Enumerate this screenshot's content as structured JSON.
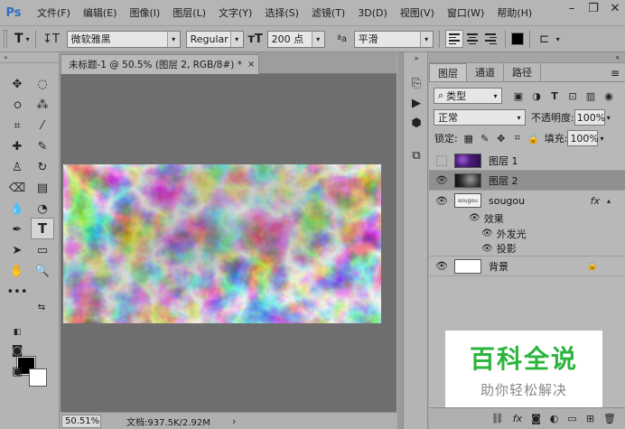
{
  "menubar": {
    "logo": "Ps",
    "items": [
      "文件(F)",
      "编辑(E)",
      "图像(I)",
      "图层(L)",
      "文字(Y)",
      "选择(S)",
      "滤镜(T)",
      "3D(D)",
      "视图(V)",
      "窗口(W)",
      "帮助(H)"
    ],
    "controls": [
      "minimize-icon",
      "restore-icon",
      "close-icon"
    ]
  },
  "options": {
    "font_family": "微软雅黑",
    "font_style": "Regular",
    "font_size": "200 点",
    "aa_label": "ªa",
    "antialias": "平滑"
  },
  "document": {
    "tab_title": "未标题-1 @ 50.5% (图层 2, RGB/8#) *",
    "close": "×"
  },
  "status": {
    "zoom": "50.51%",
    "doc_info": "文档:937.5K/2.92M",
    "arrow": "›"
  },
  "panel": {
    "tabs": [
      "图层",
      "通道",
      "路径"
    ],
    "filter_kind": "类型",
    "blend_mode": "正常",
    "opacity_label": "不透明度:",
    "opacity_value": "100%",
    "lock_label": "锁定:",
    "fill_label": "填充:",
    "fill_value": "100%",
    "layers": [
      {
        "name": "图层 1",
        "visible": false
      },
      {
        "name": "图层 2",
        "visible": true
      },
      {
        "name": "sougou",
        "visible": true,
        "fx": "fx"
      },
      {
        "name": "背景",
        "visible": true
      }
    ],
    "effects_label": "效果",
    "effects": [
      "外发光",
      "投影"
    ],
    "bottom_icons": [
      "link-icon",
      "fx-icon",
      "mask-icon",
      "adjustment-icon",
      "group-icon",
      "new-layer-icon",
      "trash-icon"
    ],
    "thumb_text": "sougou"
  },
  "watermark": {
    "title": "百科全说",
    "subtitle": "助你轻松解决"
  },
  "colors": {
    "watermark_green": "#2bb53d",
    "foreground": "#000000",
    "background": "#ffffff"
  }
}
